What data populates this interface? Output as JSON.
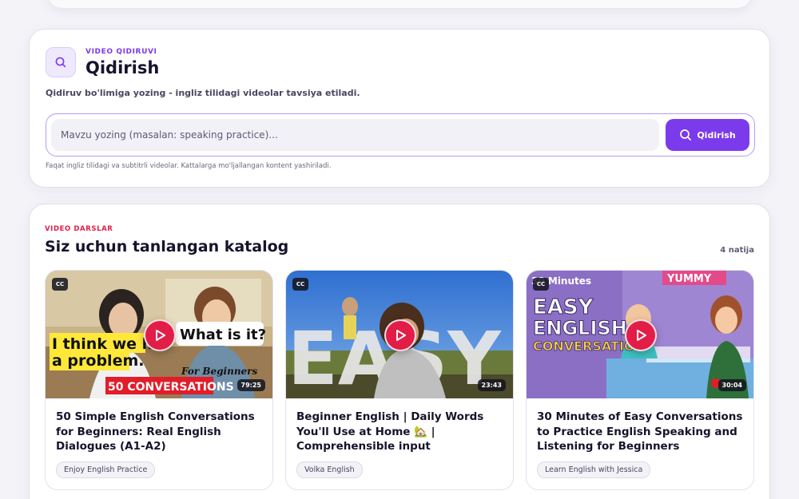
{
  "search": {
    "eyebrow": "VIDEO QIDIRUVI",
    "title": "Qidirish",
    "description": "Qidiruv bo'limiga yozing - ingliz tilidagi videolar tavsiya etiladi.",
    "placeholder": "Mavzu yozing (masalan: speaking practice)...",
    "button_label": "Qidirish",
    "hint": "Faqat ingliz tilidagi va subtitrli videolar. Kattalarga mo'ljallangan kontent yashiriladi.",
    "icon": "search-icon",
    "accent": "#7c3aed"
  },
  "catalog": {
    "eyebrow": "VIDEO DARSLAR",
    "title": "Siz uchun tanlangan katalog",
    "results": "4 natija",
    "accent": "#e11d48",
    "videos": [
      {
        "title": "50 Simple English Conversations for Beginners: Real English Dialogues (A1-A2)",
        "channel": "Enjoy English Practice",
        "duration": "79:25",
        "cc": "CC",
        "thumb_text": {
          "line1": "I think we ha",
          "line2": "a problem.",
          "bubble": "What is it?",
          "beginners": "For Beginners",
          "banner": "50 CONVERSATIONS"
        }
      },
      {
        "title": "Beginner English | Daily Words You'll Use at Home 🏡 | Comprehensible input",
        "channel": "Volka English",
        "duration": "23:43",
        "cc": "CC",
        "thumb_text": {
          "big": "EASY"
        }
      },
      {
        "title": "30 Minutes of Easy Conversations to Practice English Speaking and Listening for Beginners",
        "channel": "Learn English with Jessica",
        "duration": "30:04",
        "cc": "CC",
        "thumb_text": {
          "minutes": "30 Minutes",
          "easy": "EASY",
          "english": "ENGLISH",
          "conversation": "CONVERSATION",
          "sign": "YUMMY"
        }
      }
    ]
  }
}
